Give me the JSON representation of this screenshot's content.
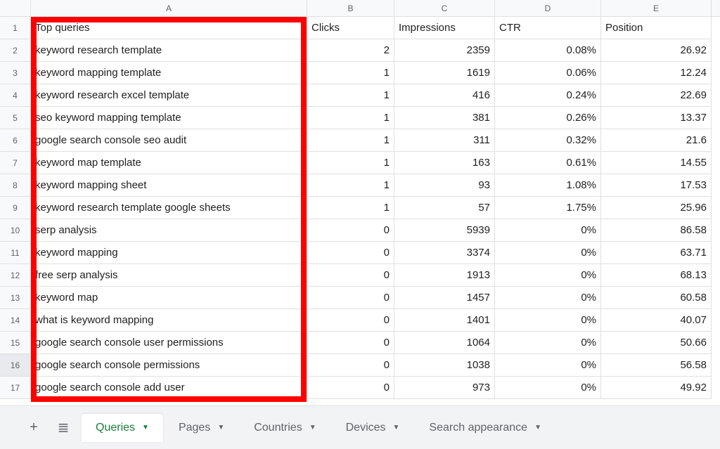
{
  "columns": [
    "A",
    "B",
    "C",
    "D",
    "E"
  ],
  "headers": {
    "A": "Top queries",
    "B": "Clicks",
    "C": "Impressions",
    "D": "CTR",
    "E": "Position"
  },
  "rows": [
    {
      "q": "keyword research template",
      "clicks": "2",
      "impr": "2359",
      "ctr": "0.08%",
      "pos": "26.92"
    },
    {
      "q": "keyword mapping template",
      "clicks": "1",
      "impr": "1619",
      "ctr": "0.06%",
      "pos": "12.24"
    },
    {
      "q": "keyword research excel template",
      "clicks": "1",
      "impr": "416",
      "ctr": "0.24%",
      "pos": "22.69"
    },
    {
      "q": "seo keyword mapping template",
      "clicks": "1",
      "impr": "381",
      "ctr": "0.26%",
      "pos": "13.37"
    },
    {
      "q": "google search console seo audit",
      "clicks": "1",
      "impr": "311",
      "ctr": "0.32%",
      "pos": "21.6"
    },
    {
      "q": "keyword map template",
      "clicks": "1",
      "impr": "163",
      "ctr": "0.61%",
      "pos": "14.55"
    },
    {
      "q": "keyword mapping sheet",
      "clicks": "1",
      "impr": "93",
      "ctr": "1.08%",
      "pos": "17.53"
    },
    {
      "q": "keyword research template google sheets",
      "clicks": "1",
      "impr": "57",
      "ctr": "1.75%",
      "pos": "25.96"
    },
    {
      "q": "serp analysis",
      "clicks": "0",
      "impr": "5939",
      "ctr": "0%",
      "pos": "86.58"
    },
    {
      "q": "keyword mapping",
      "clicks": "0",
      "impr": "3374",
      "ctr": "0%",
      "pos": "63.71"
    },
    {
      "q": "free serp analysis",
      "clicks": "0",
      "impr": "1913",
      "ctr": "0%",
      "pos": "68.13"
    },
    {
      "q": "keyword map",
      "clicks": "0",
      "impr": "1457",
      "ctr": "0%",
      "pos": "60.58"
    },
    {
      "q": "what is keyword mapping",
      "clicks": "0",
      "impr": "1401",
      "ctr": "0%",
      "pos": "40.07"
    },
    {
      "q": "google search console user permissions",
      "clicks": "0",
      "impr": "1064",
      "ctr": "0%",
      "pos": "50.66"
    },
    {
      "q": "google search console permissions",
      "clicks": "0",
      "impr": "1038",
      "ctr": "0%",
      "pos": "56.58"
    },
    {
      "q": "google search console add user",
      "clicks": "0",
      "impr": "973",
      "ctr": "0%",
      "pos": "49.92"
    }
  ],
  "tabs": [
    {
      "label": "Queries",
      "active": true
    },
    {
      "label": "Pages",
      "active": false
    },
    {
      "label": "Countries",
      "active": false
    },
    {
      "label": "Devices",
      "active": false
    },
    {
      "label": "Search appearance",
      "active": false
    }
  ],
  "icons": {
    "plus": "+",
    "menu": "≣",
    "caret": "▼"
  },
  "selectedRow": 16
}
